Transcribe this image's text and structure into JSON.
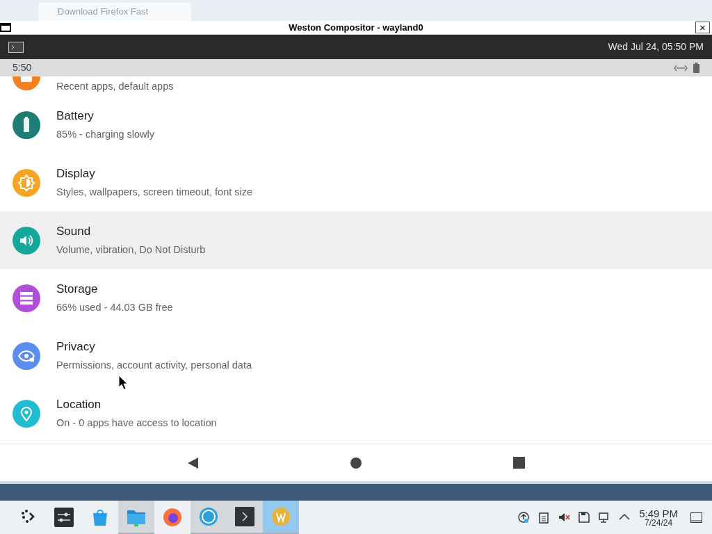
{
  "browser_tab": {
    "title": "Download Firefox Fast"
  },
  "window": {
    "title": "Weston Compositor - wayland0",
    "close": "×"
  },
  "weston_panel": {
    "clock": "Wed Jul 24, 05:50 PM"
  },
  "android_status": {
    "time": "5:50"
  },
  "settings": [
    {
      "kind": "apps",
      "subtitle": "Recent apps, default apps",
      "color": "#f4801f",
      "selected": false
    },
    {
      "kind": "battery",
      "title": "Battery",
      "subtitle": "85% - charging slowly",
      "color": "#1e7d74",
      "selected": false
    },
    {
      "kind": "display",
      "title": "Display",
      "subtitle": "Styles, wallpapers, screen timeout, font size",
      "color": "#f5a524",
      "selected": false
    },
    {
      "kind": "sound",
      "title": "Sound",
      "subtitle": "Volume, vibration, Do Not Disturb",
      "color": "#14a89c",
      "selected": true
    },
    {
      "kind": "storage",
      "title": "Storage",
      "subtitle": "66% used - 44.03 GB free",
      "color": "#b04fd8",
      "selected": false
    },
    {
      "kind": "privacy",
      "title": "Privacy",
      "subtitle": "Permissions, account activity, personal data",
      "color": "#5b8def",
      "selected": false
    },
    {
      "kind": "location",
      "title": "Location",
      "subtitle": "On - 0 apps have access to location",
      "color": "#22bcd2",
      "selected": false
    }
  ],
  "taskbar": {
    "apps": [
      {
        "kind": "launcher",
        "running": false,
        "selected": false
      },
      {
        "kind": "settings",
        "running": false,
        "selected": false
      },
      {
        "kind": "store",
        "running": false,
        "selected": false
      },
      {
        "kind": "files",
        "running": true,
        "selected": false
      },
      {
        "kind": "firefox",
        "running": false,
        "selected": false
      },
      {
        "kind": "circle",
        "running": true,
        "selected": false
      },
      {
        "kind": "terminal",
        "running": true,
        "selected": false
      },
      {
        "kind": "w",
        "running": true,
        "selected": true
      }
    ],
    "time": "5:49 PM",
    "date": "7/24/24"
  }
}
